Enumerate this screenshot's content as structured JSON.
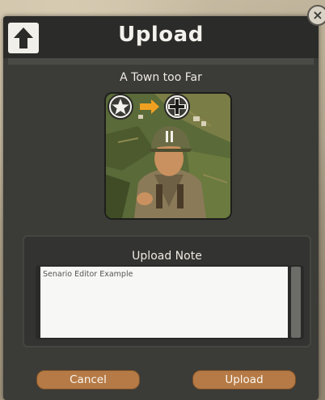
{
  "dialog": {
    "title": "Upload",
    "upload_icon": "upload-arrow-icon",
    "close_icon": "close-icon",
    "close_glyph": "×"
  },
  "scenario": {
    "name": "A Town too Far",
    "thumbnail_icons": [
      "allied-star-icon",
      "arrow-right-icon",
      "axis-cross-icon"
    ]
  },
  "note": {
    "label": "Upload Note",
    "value": "Senario Editor Example"
  },
  "actions": {
    "cancel_label": "Cancel",
    "upload_label": "Upload"
  },
  "colors": {
    "dialog_bg": "#3b3b38",
    "header_bg": "#2b2b29",
    "button": "#b57a45",
    "arrow": "#f0a020"
  }
}
